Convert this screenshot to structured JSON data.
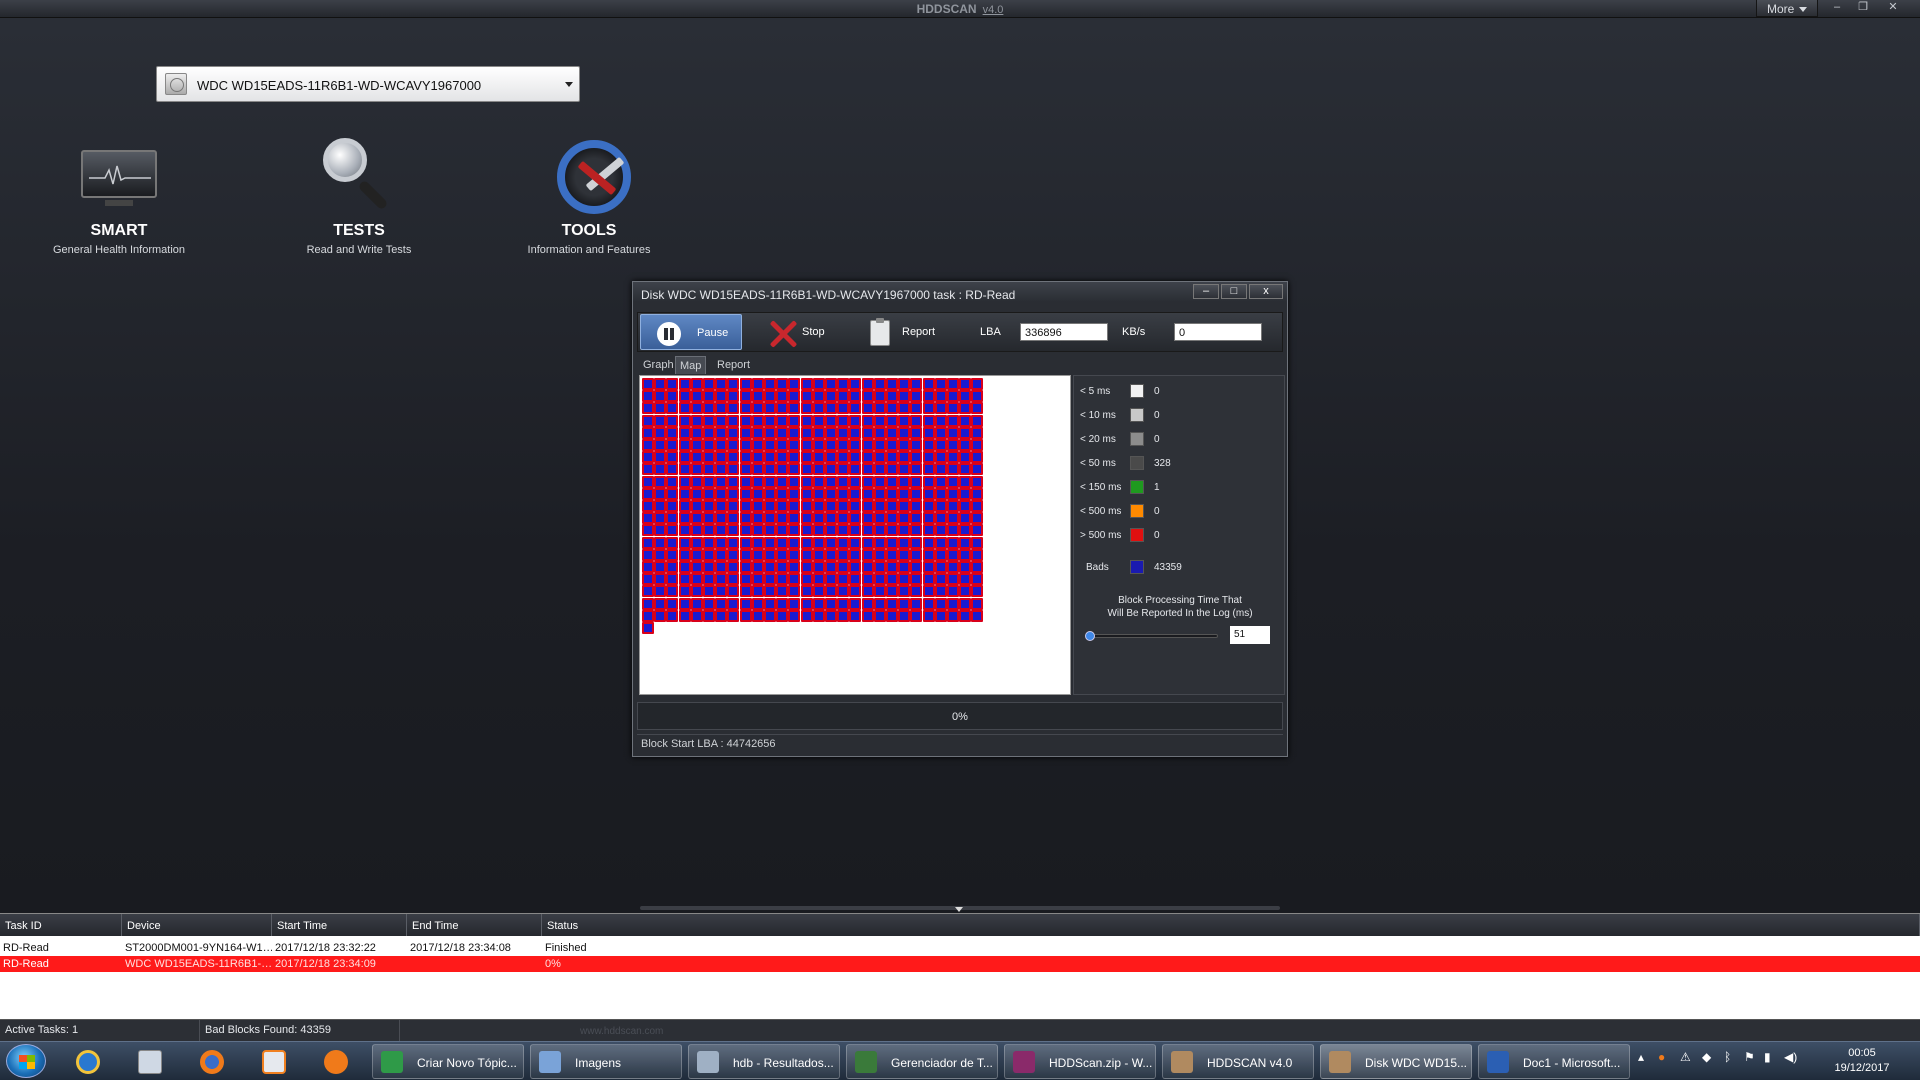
{
  "app": {
    "title": "HDDSCAN",
    "version": "v4.0",
    "more_label": "More"
  },
  "drive": {
    "selected": "WDC WD15EADS-11R6B1-WD-WCAVY1967000"
  },
  "features": [
    {
      "name": "SMART",
      "subtitle": "General Health Information",
      "icon": "monitor-heartbeat-icon"
    },
    {
      "name": "TESTS",
      "subtitle": "Read and Write Tests",
      "icon": "magnifier-icon"
    },
    {
      "name": "TOOLS",
      "subtitle": "Information and Features",
      "icon": "tools-gear-icon"
    }
  ],
  "dialog": {
    "title": "Disk WDC WD15EADS-11R6B1-WD-WCAVY1967000   task : RD-Read",
    "controls": {
      "minimize": "–",
      "maximize": "□",
      "close": "x"
    },
    "toolbar": {
      "pause_label": "Pause",
      "stop_label": "Stop",
      "report_label": "Report",
      "lba_label": "LBA",
      "lba_value": "336896",
      "kbs_label": "KB/s",
      "kbs_value": "0"
    },
    "tabs": [
      "Graph",
      "Map",
      "Report"
    ],
    "active_tab": "Map",
    "legend": [
      {
        "label": "< 5 ms",
        "color": "#f2f2f2",
        "count": "0"
      },
      {
        "label": "< 10 ms",
        "color": "#c8c8c8",
        "count": "0"
      },
      {
        "label": "< 20 ms",
        "color": "#8c8c8c",
        "count": "0"
      },
      {
        "label": "< 50 ms",
        "color": "#4a4a4a",
        "count": "328"
      },
      {
        "label": "< 150 ms",
        "color": "#1f9a1f",
        "count": "1"
      },
      {
        "label": "< 500 ms",
        "color": "#ff8a00",
        "count": "0"
      },
      {
        "label": "> 500 ms",
        "color": "#e01010",
        "count": "0"
      }
    ],
    "bads": {
      "label": "Bads",
      "color": "#1a1ab0",
      "count": "43359"
    },
    "block_time_text_1": "Block Processing Time That",
    "block_time_text_2": "Will Be Reported In the Log (ms)",
    "block_time_value": "51",
    "progress_text": "0%",
    "status_text": "Block Start LBA : 44742656"
  },
  "task_table": {
    "headers": [
      "Task ID",
      "Device",
      "Start Time",
      "End Time",
      "Status"
    ],
    "rows": [
      {
        "task_id": "RD-Read",
        "device": "ST2000DM001-9YN164-W1…",
        "start": "2017/12/18 23:32:22",
        "end": "2017/12/18 23:34:08",
        "status": "Finished",
        "highlight": false
      },
      {
        "task_id": "RD-Read",
        "device": "WDC WD15EADS-11R6B1-…",
        "start": "2017/12/18 23:34:09",
        "end": "",
        "status": "0%",
        "highlight": true
      }
    ]
  },
  "statusbar": {
    "active_tasks": "Active Tasks: 1",
    "bad_blocks": "Bad Blocks Found: 43359",
    "watermark": "www.hddscan.com"
  },
  "taskbar": {
    "pinned": [
      "internet-explorer-icon",
      "calculator-icon",
      "firefox-icon",
      "media-player-icon",
      "avast-icon"
    ],
    "buttons": [
      {
        "label": "Criar Novo Tópic...",
        "icon": "chrome-icon",
        "color": "#2f9a48"
      },
      {
        "label": "Imagens",
        "icon": "folder-icon",
        "color": "#7aa3d8"
      },
      {
        "label": "hdb - Resultados...",
        "icon": "search-icon",
        "color": "#9fb0c4"
      },
      {
        "label": "Gerenciador de T...",
        "icon": "task-manager-icon",
        "color": "#3a7a3a"
      },
      {
        "label": "HDDScan.zip - W...",
        "icon": "winrar-icon",
        "color": "#8a2a6a"
      },
      {
        "label": "HDDSCAN v4.0",
        "icon": "hddscan-icon",
        "color": "#b08a60"
      },
      {
        "label": "Disk WDC WD15...",
        "icon": "hddscan-icon",
        "color": "#b08a60",
        "active": true
      },
      {
        "label": "Doc1 - Microsoft...",
        "icon": "word-icon",
        "color": "#2b5fb3"
      }
    ],
    "clock_time": "00:05",
    "clock_date": "19/12/2017"
  }
}
